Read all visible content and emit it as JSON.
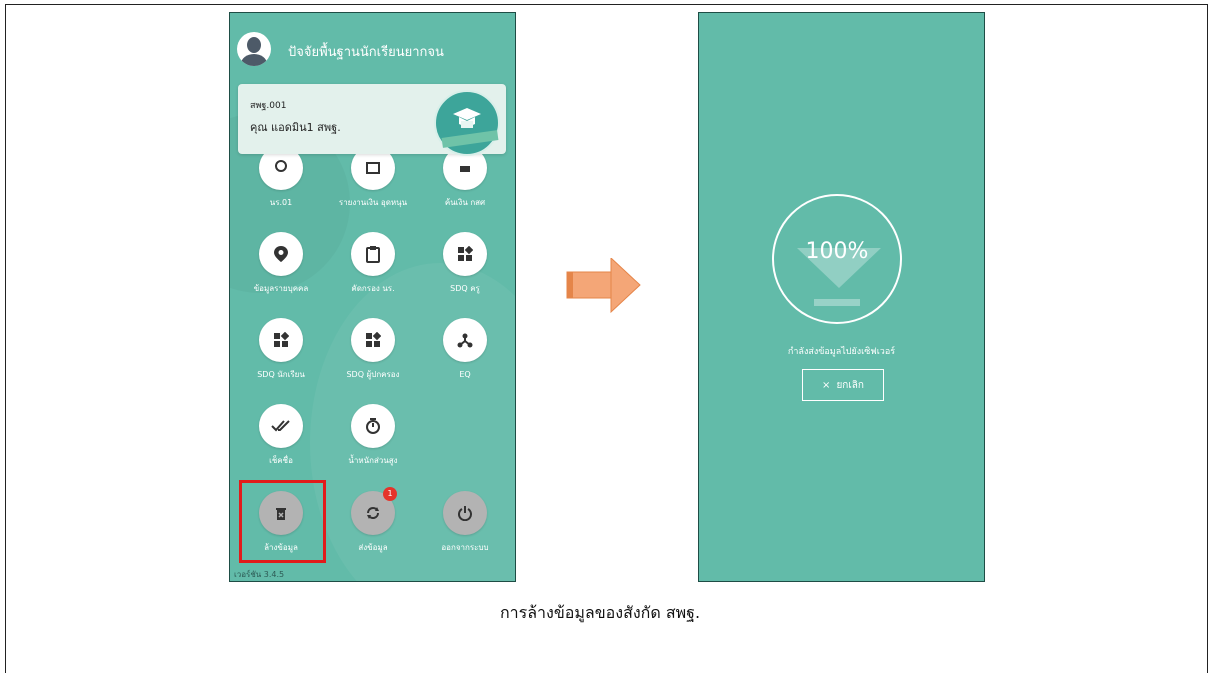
{
  "left_phone": {
    "app_title": "ปัจจัยพื้นฐานนักเรียนยากจน",
    "user_code": "สพฐ.001",
    "user_name": "คุณ แอดมิน1 สพฐ.",
    "top_row": [
      {
        "label": "นร.01",
        "icon": "person-icon"
      },
      {
        "label": "รายงานเงิน อุดหนุน",
        "icon": "report-icon"
      },
      {
        "label": "ค้นเงิน กสศ",
        "icon": "money-icon"
      }
    ],
    "rows": [
      [
        {
          "label": "ข้อมูลรายบุคคล",
          "icon": "location-pin-icon"
        },
        {
          "label": "คัดกรอง นร.",
          "icon": "clipboard-icon"
        },
        {
          "label": "SDQ ครู",
          "icon": "dashboard-icon"
        }
      ],
      [
        {
          "label": "SDQ นักเรียน",
          "icon": "dashboard-icon"
        },
        {
          "label": "SDQ ผู้ปกครอง",
          "icon": "dashboard-icon"
        },
        {
          "label": "EQ",
          "icon": "hub-icon"
        }
      ],
      [
        {
          "label": "เช็คชื่อ",
          "icon": "double-check-icon"
        },
        {
          "label": "น้ำหนักส่วนสูง",
          "icon": "timer-icon"
        }
      ]
    ],
    "bottom_row": [
      {
        "label": "ล้างข้อมูล",
        "icon": "trash-icon"
      },
      {
        "label": "ส่งข้อมูล",
        "icon": "sync-icon",
        "badge": "1"
      },
      {
        "label": "ออกจากระบบ",
        "icon": "power-icon"
      }
    ],
    "version": "เวอร์ชัน 3.4.5"
  },
  "right_phone": {
    "progress_percent": "100%",
    "progress_value": 1.0,
    "sending_text": "กำลังส่งข้อมูลไปยังเซิฟเวอร์",
    "cancel_label": "ยกเลิก",
    "cancel_icon": "×"
  },
  "caption": "การล้างข้อมูลของสังกัด สพฐ.",
  "colors": {
    "app_bg": "#62bba9",
    "highlight": "#e21b1b",
    "arrow": "#f4a677",
    "badge": "#e5342b"
  }
}
